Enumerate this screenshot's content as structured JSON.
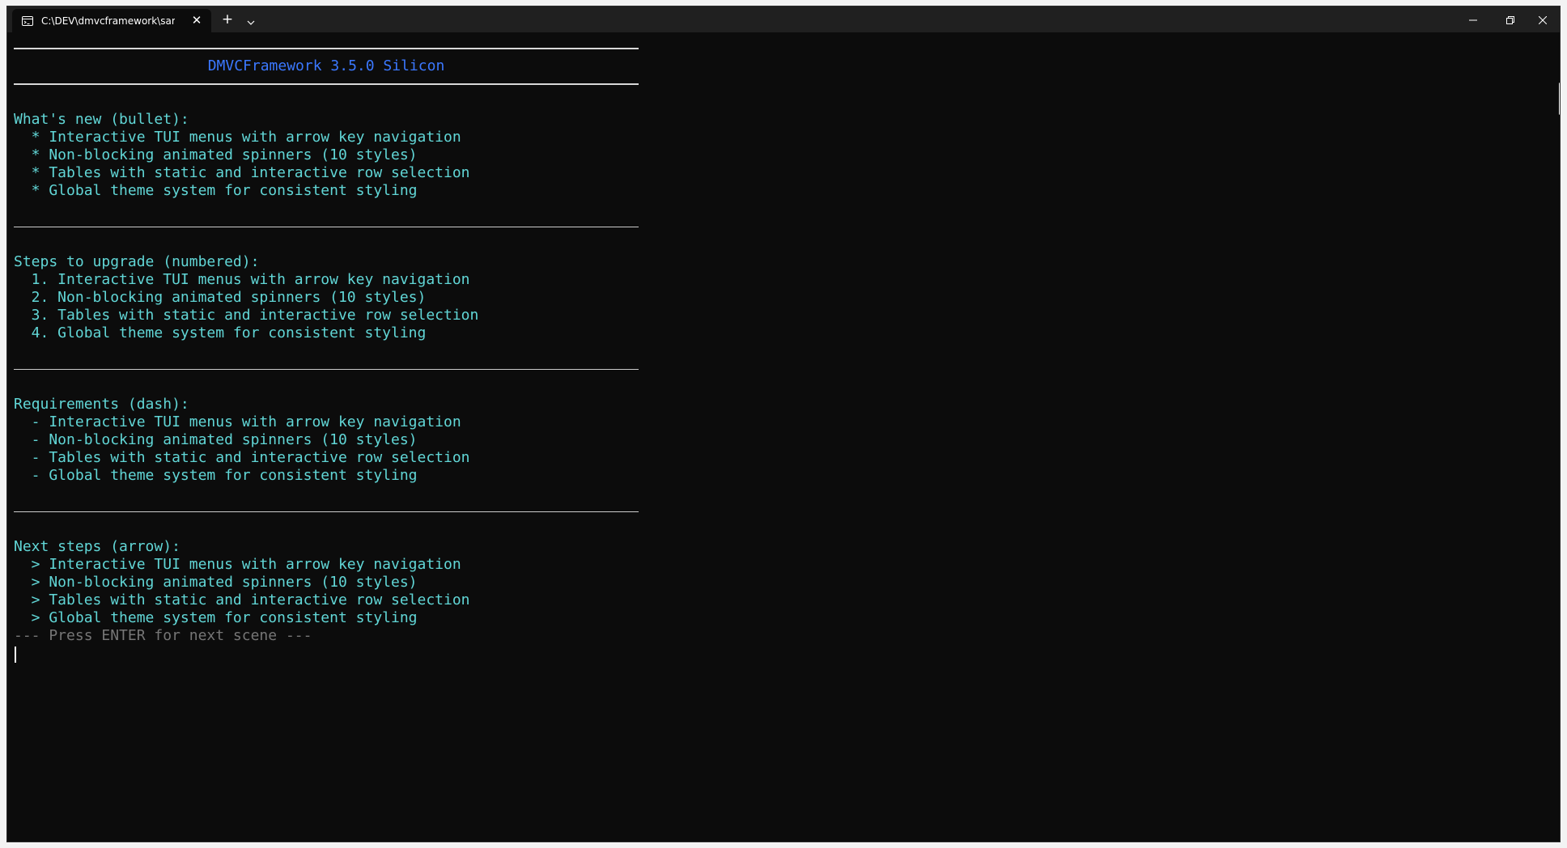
{
  "tab": {
    "title": "C:\\DEV\\dmvcframework\\sam|",
    "close_glyph": "✕"
  },
  "titlebar": {
    "new_tab_glyph": "+"
  },
  "terminal": {
    "banner_title": "DMVCFramework 3.5.0 Silicon",
    "sections": [
      {
        "heading": "What's new (bullet):",
        "items": [
          "  * Interactive TUI menus with arrow key navigation",
          "  * Non-blocking animated spinners (10 styles)",
          "  * Tables with static and interactive row selection",
          "  * Global theme system for consistent styling"
        ]
      },
      {
        "heading": "Steps to upgrade (numbered):",
        "items": [
          "  1. Interactive TUI menus with arrow key navigation",
          "  2. Non-blocking animated spinners (10 styles)",
          "  3. Tables with static and interactive row selection",
          "  4. Global theme system for consistent styling"
        ]
      },
      {
        "heading": "Requirements (dash):",
        "items": [
          "  - Interactive TUI menus with arrow key navigation",
          "  - Non-blocking animated spinners (10 styles)",
          "  - Tables with static and interactive row selection",
          "  - Global theme system for consistent styling"
        ]
      },
      {
        "heading": "Next steps (arrow):",
        "items": [
          "  > Interactive TUI menus with arrow key navigation",
          "  > Non-blocking animated spinners (10 styles)",
          "  > Tables with static and interactive row selection",
          "  > Global theme system for consistent styling"
        ]
      }
    ],
    "prompt": "--- Press ENTER for next scene ---"
  },
  "colors": {
    "background": "#0c0c0c",
    "titlebar": "#202020",
    "text_cyan": "#61d6d6",
    "title_blue": "#3b78ff",
    "prompt_gray": "#767676",
    "rule": "#d8d8d8"
  },
  "icons": {
    "tab": "terminal-icon",
    "dropdown": "chevron-down-icon",
    "minimize": "minimize-icon",
    "maximize": "restore-icon",
    "close": "close-icon"
  }
}
